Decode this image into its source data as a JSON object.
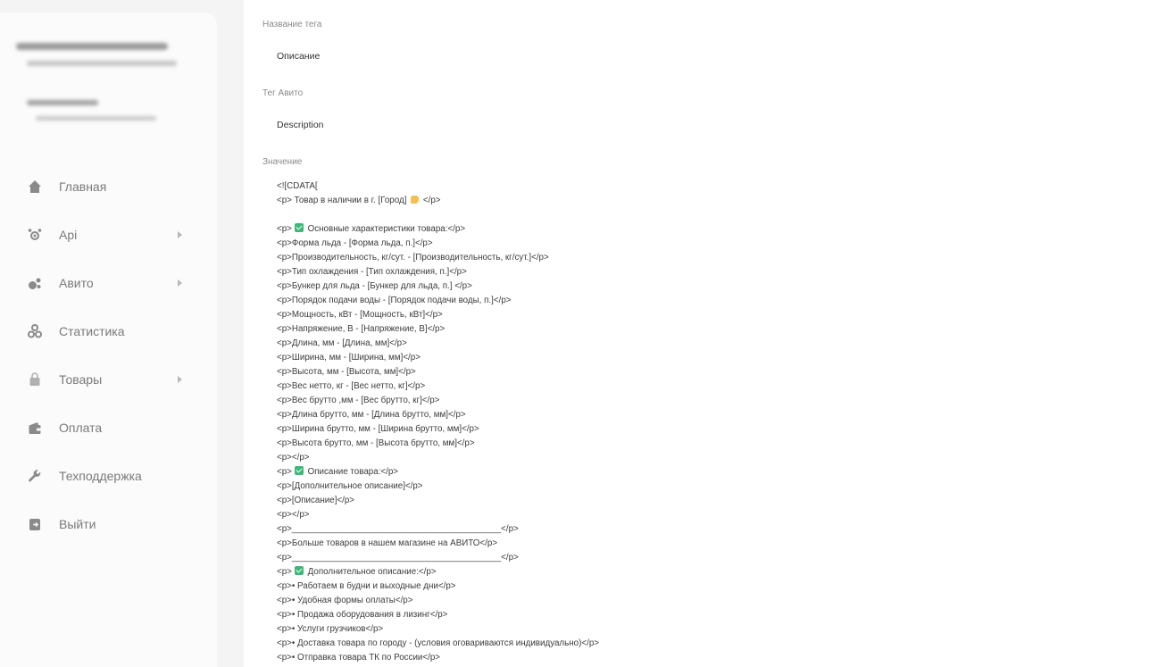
{
  "sidebar": {
    "items": [
      {
        "label": "Главная",
        "icon": "home-icon",
        "has_submenu": false
      },
      {
        "label": "Api",
        "icon": "api-icon",
        "has_submenu": true
      },
      {
        "label": "Авито",
        "icon": "avito-icon",
        "has_submenu": true
      },
      {
        "label": "Статистика",
        "icon": "statistics-icon",
        "has_submenu": false
      },
      {
        "label": "Товары",
        "icon": "products-icon",
        "has_submenu": true
      },
      {
        "label": "Оплата",
        "icon": "wallet-icon",
        "has_submenu": false
      },
      {
        "label": "Техподдержка",
        "icon": "wrench-icon",
        "has_submenu": false
      },
      {
        "label": "Выйти",
        "icon": "logout-icon",
        "has_submenu": false
      }
    ]
  },
  "form": {
    "tag_name": {
      "label": "Название тега",
      "value": "Описание"
    },
    "avito_tag": {
      "label": "Тег Авито",
      "value": "Description"
    },
    "value": {
      "label": "Значение",
      "lines": [
        "<![CDATA[",
        "<p> Товар в наличии в г. [Город] ",
        "",
        "<p>",
        "<p>Форма льда - [Форма льда, п.]</p>",
        "<p>Производительность, кг/сут. - [Производительность, кг/сут.]</p>",
        "<p>Тип охлаждения - [Тип охлаждения, п.]</p>",
        "<p>Бункер для льда - [Бункер для льда, п.] </p>",
        "<p>Порядок подачи воды - [Порядок подачи воды, п.]</p>",
        "<p>Мощность, кВт - [Мощность, кВт]</p>",
        "<p>Напряжение, В - [Напряжение, В]</p>",
        "<p>Длина, мм - [Длина, мм]</p>",
        "<p>Ширина, мм - [Ширина, мм]</p>",
        "<p>Высота, мм - [Высота, мм]</p>",
        "<p>Вес нетто, кг - [Вес нетто, кг]</p>",
        "<p>Вес брутто ,мм - [Вес брутто, кг]</p>",
        "<p>Длина брутто, мм - [Длина брутто, мм]</p>",
        "<p>Ширина брутто, мм - [Ширина брутто, мм]</p>",
        "<p>Высота брутто, мм - [Высота брутто, мм]</p>",
        "<p></p>",
        "<p>",
        "<p>[Дополнительное описание]</p>",
        "<p>[Описание]</p>",
        "<p></p>",
        "<p>___________________________________________</p>",
        "<p>Больше товаров в нашем магазине на АВИТО</p>",
        "<p>___________________________________________</p>",
        "<p>",
        "<p>• Работаем в будни и выходные дни</p>",
        "<p>• Удобная формы оплаты</p>",
        "<p>• Продажа оборудования в лизинг</p>",
        "<p>• Услуги грузчиков</p>",
        "<p>• Доставка товара по городу - (условия оговариваются индивидуально)</p>",
        "<p>• Отправка товара ТК по России</p>"
      ],
      "check_texts": {
        "3": " Основные характеристики товара:</p>",
        "20": " Описание товара:</p>",
        "27": " Дополнительное описание:</p>"
      },
      "thumb_suffix": " </p>"
    }
  },
  "colors": {
    "check": "#3cb878",
    "sidebar_bg": "#f4f4f4",
    "panel_bg": "#fbfbfb"
  }
}
